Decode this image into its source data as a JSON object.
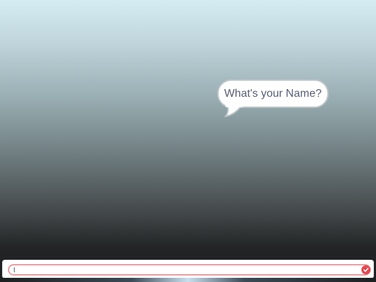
{
  "stage": {
    "background_top_color": "#d5ecf3",
    "background_bottom_color": "#1d1f20"
  },
  "speech_bubble": {
    "text": "What's your Name?",
    "text_color": "#575e75"
  },
  "ask_prompt": {
    "input_value": "",
    "accent_color": "#e5474f",
    "submit_icon": "check-icon"
  }
}
